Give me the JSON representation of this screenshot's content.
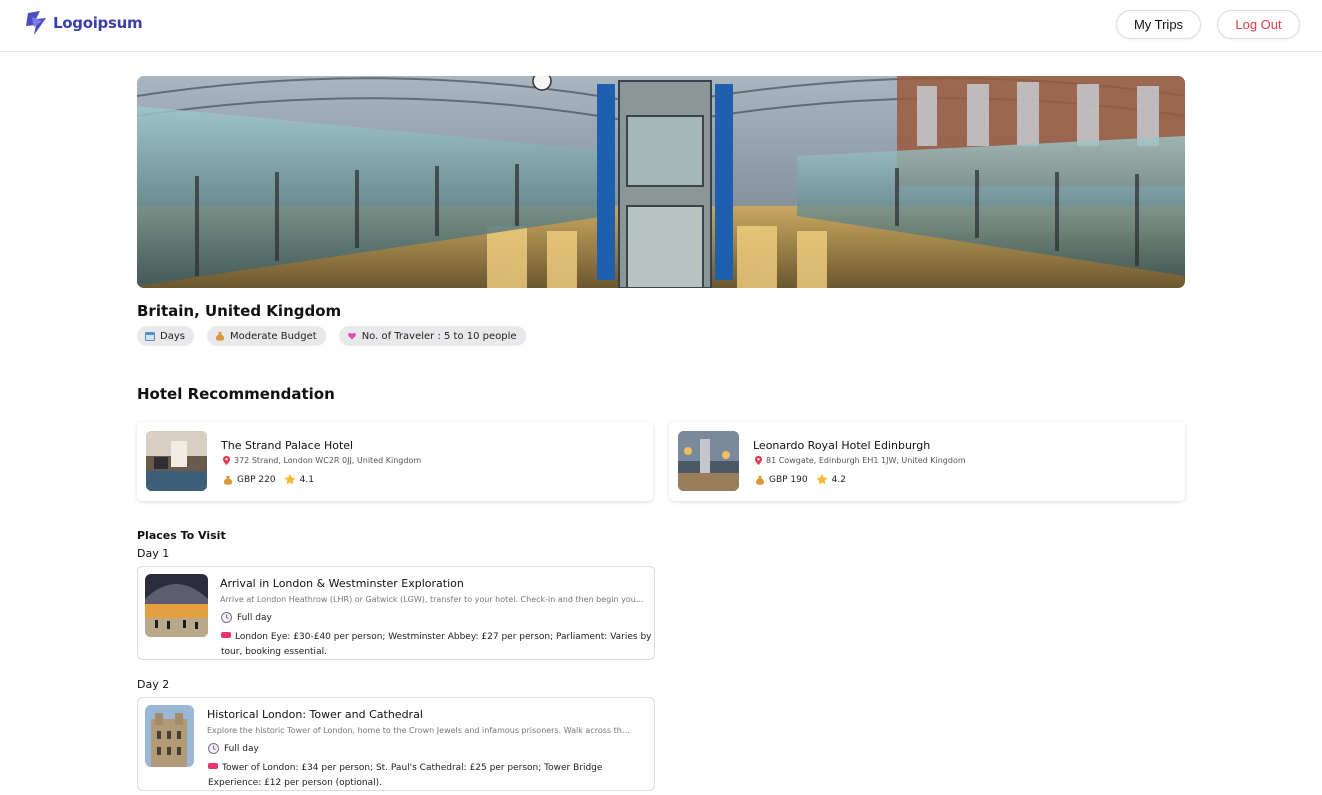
{
  "header": {
    "logo_text": "Logoipsum",
    "my_trips_label": "My Trips",
    "logout_label": "Log Out"
  },
  "trip": {
    "destination": "Britain, United Kingdom",
    "chips": {
      "days": "Days",
      "budget": "Moderate Budget",
      "travelers": "No. of Traveler : 5 to 10 people"
    }
  },
  "hotels": {
    "section_title": "Hotel Recommendation",
    "items": [
      {
        "name": "The Strand Palace Hotel",
        "address": "372 Strand, London WC2R 0JJ, United Kingdom",
        "price": "GBP 220",
        "rating": "4.1"
      },
      {
        "name": "Leonardo Royal Hotel Edinburgh",
        "address": "81 Cowgate, Edinburgh EH1 1JW, United Kingdom",
        "price": "GBP 190",
        "rating": "4.2"
      }
    ]
  },
  "places": {
    "section_title": "Places To Visit",
    "days": [
      {
        "label": "Day 1",
        "name": "Arrival in London & Westminster Exploration",
        "description": "Arrive at London Heathrow (LHR) or Gatwick (LGW), transfer to your hotel. Check-in and then begin your exp...",
        "time": "Full day",
        "price": "London Eye: £30-£40 per person; Westminster Abbey: £27 per person; Parliament: Varies by tour, booking essential."
      },
      {
        "label": "Day 2",
        "name": "Historical London: Tower and Cathedral",
        "description": "Explore the historic Tower of London, home to the Crown Jewels and infamous prisoners. Walk across the ico...",
        "time": "Full day",
        "price": "Tower of London: £34 per person; St. Paul's Cathedral: £25 per person; Tower Bridge Experience: £12 per person (optional)."
      }
    ]
  },
  "colors": {
    "brand": "#3b3fa8",
    "logout": "#e53945",
    "chip_bg": "#e9e9ec",
    "ticket": "#e8336d"
  }
}
